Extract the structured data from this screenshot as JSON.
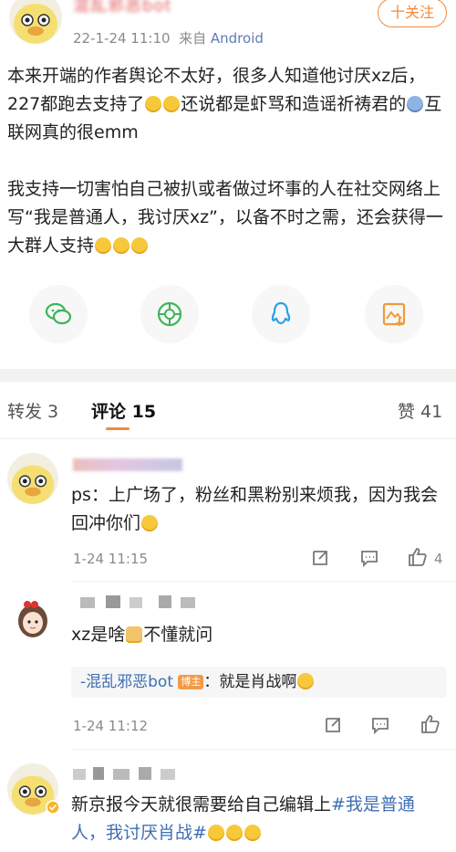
{
  "header": {
    "username": "混乱邪恶bot",
    "date": "22-1-24 11:10",
    "from": "来自",
    "source": "Android",
    "follow": "十关注"
  },
  "post": {
    "p1_a": "本来开端的作者舆论不太好，很多人知道他讨厌xz后，227都跑去支持了",
    "p1_b": "还说都是虾骂和造谣祈祷君的",
    "p1_c": "互联网真的很emm",
    "p2": "我支持一切害怕自己被扒或者做过坏事的人在社交网络上写“我是普通人，我讨厌xz”，以备不时之需，还会获得一大群人支持"
  },
  "share_icons": [
    "wechat-icon",
    "moments-icon",
    "qq-icon",
    "save-image-icon"
  ],
  "tabs": {
    "repost": "转发 3",
    "comments": "评论 15",
    "likes": "赞 41"
  },
  "comments": [
    {
      "text": "ps：上广场了，粉丝和黑粉别来烦我，因为我会回冲你们",
      "time": "1-24 11:15",
      "like_count": "4"
    },
    {
      "text_a": "xz是啥",
      "text_b": "不懂就问",
      "reply_user": "-混乱邪恶bot",
      "reply_badge": "博主",
      "reply_text": "：就是肖战啊",
      "time": "1-24 11:12"
    },
    {
      "text_a": "新京报今天就很需要给自己编辑上",
      "hashtag": "#我是普通人，我讨厌肖战#"
    }
  ],
  "colors": {
    "accent": "#f28a3c",
    "link": "#3f6fb3",
    "muted": "#8a8a8a"
  }
}
